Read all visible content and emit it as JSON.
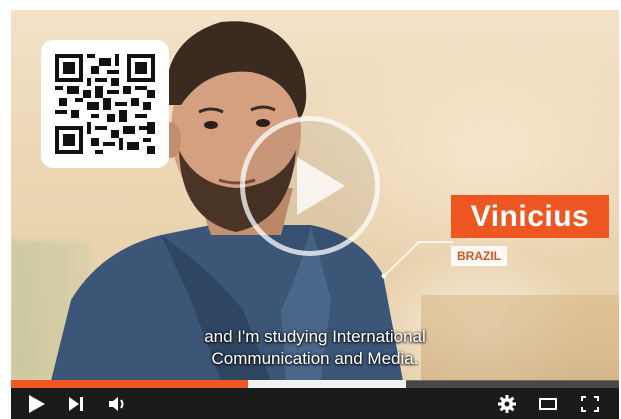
{
  "overlay": {
    "name": "Vinicius",
    "country": "BRAZIL"
  },
  "subtitles": {
    "line1": "and I'm studying International",
    "line2": "Communication and Media."
  },
  "player": {
    "progress_played": 0.39,
    "progress_buffered": 0.65,
    "accent_color": "#ee5722"
  },
  "icons": {
    "play": "play-icon",
    "next": "skip-next-icon",
    "volume": "volume-icon",
    "settings": "gear-icon",
    "theater": "theater-mode-icon",
    "fullscreen": "fullscreen-icon"
  }
}
